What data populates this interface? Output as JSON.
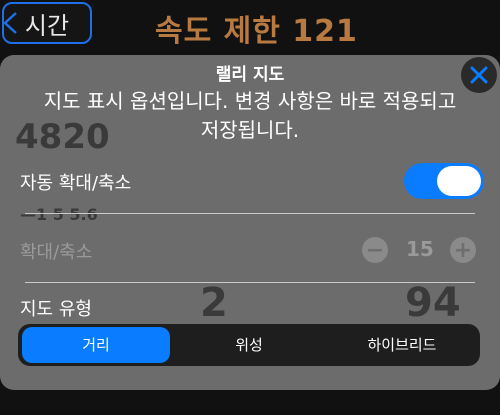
{
  "background": {
    "back_button": "시간",
    "title": "속도 제한 121",
    "ghost_texts": [
      "4820",
      "—1 5 5.6",
      "2",
      "94"
    ]
  },
  "sheet": {
    "title": "랠리 지도",
    "description": "지도 표시 옵션입니다. 변경 사항은 바로 적용되고 저장됩니다.",
    "auto_zoom": {
      "label": "자동 확대/축소",
      "enabled": true
    },
    "zoom": {
      "label": "확대/축소",
      "value": "15",
      "minus": "−",
      "plus": "+",
      "disabled": true
    },
    "map_type": {
      "label": "지도 유형",
      "options": [
        "거리",
        "위성",
        "하이브리드"
      ],
      "selected": "거리"
    }
  },
  "colors": {
    "accent": "#0a7cff",
    "title_orange": "#b87a40",
    "back_border": "#1f6fe6"
  }
}
